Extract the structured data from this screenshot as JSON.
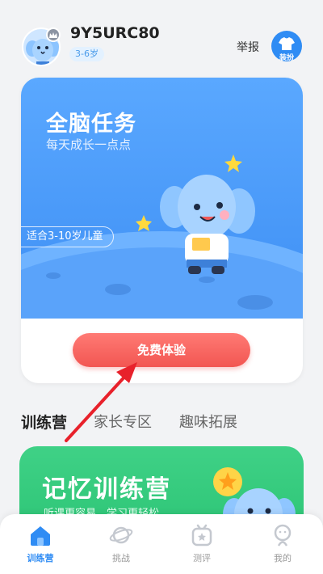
{
  "header": {
    "username": "9Y5URC80",
    "age_badge": "3-6岁",
    "report_label": "举报",
    "dress_label": "装扮"
  },
  "card": {
    "title": "全脑任务",
    "subtitle": "每天成长一点点",
    "age_pill": "适合3-10岁儿童",
    "cta_label": "免费体验"
  },
  "tabs": [
    "训练营",
    "家长专区",
    "趣味拓展"
  ],
  "banner": {
    "title": "记忆训练营",
    "subtitle": "听课更容易，学习更轻松"
  },
  "nav": [
    {
      "label": "训练营",
      "icon": "home-icon",
      "active": true
    },
    {
      "label": "挑战",
      "icon": "planet-icon",
      "active": false
    },
    {
      "label": "测评",
      "icon": "test-icon",
      "active": false
    },
    {
      "label": "我的",
      "icon": "profile-icon",
      "active": false
    }
  ],
  "colors": {
    "accent": "#2f8cf4",
    "card_blue": "#4a9bf8",
    "cta_red": "#f25652",
    "banner_green": "#35cb7d",
    "annotation_arrow": "#e8212b"
  }
}
